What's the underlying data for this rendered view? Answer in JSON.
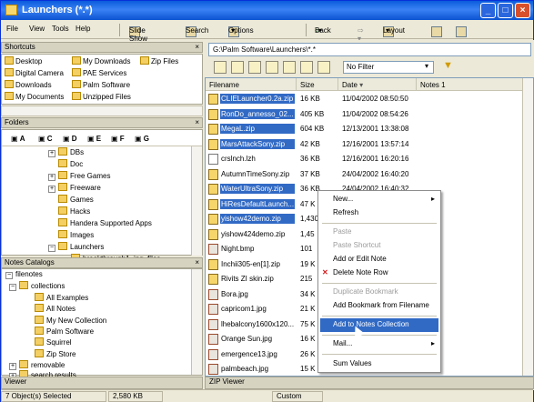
{
  "window": {
    "title": "Launchers (*.*)",
    "controls": [
      "_",
      "□",
      "×"
    ]
  },
  "menu": [
    "File",
    "View",
    "Tools",
    "Help"
  ],
  "toolbar": {
    "slideshow": "Slide Show",
    "search": "Search",
    "options": "Options",
    "back": "Back",
    "layout": "Layout"
  },
  "shortcuts": {
    "title": "Shortcuts",
    "items": [
      "Desktop",
      "My Downloads",
      "Zip Files",
      "Digital Camera",
      "PAE Services",
      "Downloads",
      "Palm Software",
      "My Documents",
      "Unzipped Files"
    ]
  },
  "folders": {
    "title": "Folders",
    "drives": [
      "A",
      "C",
      "D",
      "E",
      "F",
      "G"
    ],
    "tree": [
      "DBs",
      "Doc",
      "Free Games",
      "Freeware",
      "Games",
      "Hacks",
      "Handera Supported Apps",
      "Images",
      "Launchers",
      "breakthrough1_jpg_files"
    ]
  },
  "notes": {
    "title": "Notes Catalogs",
    "tree": [
      "filenotes",
      "collections",
      "All Examples",
      "All Notes",
      "My New Collection",
      "Palm Software",
      "Squirrel",
      "Zip Store",
      "removable",
      "search results"
    ]
  },
  "viewer_left": "Viewer",
  "address": "G:\\Palm Software\\Launchers\\*.*",
  "filter": "No Filter",
  "columns": [
    "Filename",
    "Size",
    "Date",
    "Notes 1"
  ],
  "files": [
    {
      "name": "CLIELauncher0.2a.zip",
      "size": "16 KB",
      "date": "11/04/2002 08:50:50",
      "selected": true,
      "type": "zip"
    },
    {
      "name": "RonDo_annesso_02...",
      "size": "405 KB",
      "date": "11/04/2002 08:54:26",
      "selected": true,
      "type": "zip"
    },
    {
      "name": "MegaL.zip",
      "size": "604 KB",
      "date": "12/13/2001 13:38:08",
      "selected": true,
      "type": "zip"
    },
    {
      "name": "MarsAttackSony.zip",
      "size": "42 KB",
      "date": "12/16/2001 13:57:14",
      "selected": true,
      "type": "zip"
    },
    {
      "name": "crslnch.lzh",
      "size": "36 KB",
      "date": "12/16/2001 16:20:16",
      "selected": false,
      "type": "txt"
    },
    {
      "name": "AutumnTimeSony.zip",
      "size": "37 KB",
      "date": "24/04/2002 16:40:20",
      "selected": false,
      "type": "zip"
    },
    {
      "name": "WaterUltraSony.zip",
      "size": "36 KB",
      "date": "24/04/2002 16:40:32",
      "selected": true,
      "type": "zip"
    },
    {
      "name": "HiResDefaultLaunch...",
      "size": "47 K",
      "date": "",
      "selected": true,
      "type": "zip"
    },
    {
      "name": "yishow42demo.zip",
      "size": "1,430",
      "date": "",
      "selected": true,
      "type": "zip"
    },
    {
      "name": "yishow424demo.zip",
      "size": "1,45",
      "date": "",
      "selected": false,
      "type": "zip"
    },
    {
      "name": "Night.bmp",
      "size": "101",
      "date": "",
      "selected": false,
      "type": "img"
    },
    {
      "name": "Inchii305-en[1].zip",
      "size": "19 K",
      "date": "",
      "selected": false,
      "type": "zip"
    },
    {
      "name": "Rivits ZI skin.zip",
      "size": "215",
      "date": "",
      "selected": false,
      "type": "zip"
    },
    {
      "name": "Bora.jpg",
      "size": "34 K",
      "date": "",
      "selected": false,
      "type": "img"
    },
    {
      "name": "capricom1.jpg",
      "size": "21 K",
      "date": "",
      "selected": false,
      "type": "img"
    },
    {
      "name": "lhebalcony1600x120...",
      "size": "75 K",
      "date": "",
      "selected": false,
      "type": "img"
    },
    {
      "name": "Orange Sun.jpg",
      "size": "16 K",
      "date": "",
      "selected": false,
      "type": "img"
    },
    {
      "name": "emergence13.jpg",
      "size": "26 K",
      "date": "",
      "selected": false,
      "type": "img"
    },
    {
      "name": "palmbeach.jpg",
      "size": "15 K",
      "date": "",
      "selected": false,
      "type": "img"
    },
    {
      "name": "Spinnerwriight.jpg",
      "size": "15 K",
      "date": "",
      "selected": false,
      "type": "img"
    }
  ],
  "context_menu": [
    {
      "label": "New...",
      "state": "normal",
      "arrow": "▸"
    },
    {
      "label": "Refresh",
      "state": "normal",
      "arrow": ""
    },
    {
      "label": "Paste",
      "state": "disabled",
      "arrow": ""
    },
    {
      "label": "Paste Shortcut",
      "state": "disabled",
      "arrow": ""
    },
    {
      "label": "Add or Edit Note",
      "state": "normal",
      "arrow": ""
    },
    {
      "label": "Delete Note Row",
      "state": "normal",
      "arrow": ""
    },
    {
      "label": "Duplicate Bookmark",
      "state": "disabled",
      "arrow": ""
    },
    {
      "label": "Add Bookmark from Filename",
      "state": "normal",
      "arrow": ""
    },
    {
      "label": "Add to Notes Collection",
      "state": "highlighted",
      "arrow": ""
    },
    {
      "label": "Mail...",
      "state": "normal",
      "arrow": "▸"
    },
    {
      "label": "Sum Values",
      "state": "normal",
      "arrow": ""
    }
  ],
  "viewer_right": "ZIP Viewer",
  "status": {
    "selected": "7 Object(s) Selected",
    "size": "2,580 KB",
    "mode": "Custom"
  }
}
